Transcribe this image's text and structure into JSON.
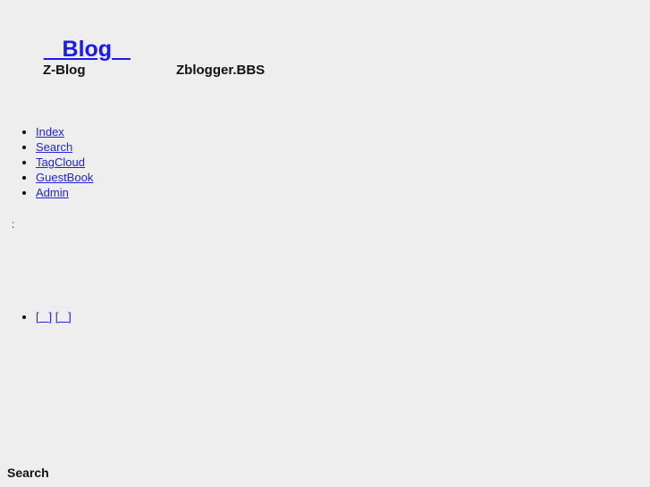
{
  "page": {
    "background_color": "#eeeeee",
    "text_color": "#000000",
    "link_color": "#2222dd",
    "title_link_color": "#1a1aee"
  },
  "masthead": {
    "site_title": "   Blog   ",
    "subtitles": [
      {
        "label": "Z-Blog"
      },
      {
        "label": "Zblogger.BBS"
      }
    ]
  },
  "navigation": {
    "items": [
      {
        "label": "Index"
      },
      {
        "label": "Search"
      },
      {
        "label": "TagCloud"
      },
      {
        "label": "GuestBook"
      },
      {
        "label": "Admin"
      }
    ]
  },
  "meta": {
    "separator": ":"
  },
  "bracket_links": {
    "items": [
      {
        "label": "[   ]"
      },
      {
        "label": "[   ]"
      }
    ]
  },
  "footer_section": {
    "heading": "Search"
  }
}
